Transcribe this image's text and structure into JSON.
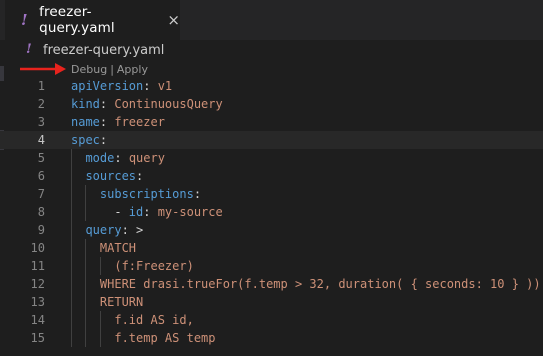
{
  "tab": {
    "icon": "yaml-file-icon",
    "label": "freezer-query.yaml",
    "close": "×"
  },
  "breadcrumb": {
    "icon": "yaml-file-icon",
    "file": "freezer-query.yaml"
  },
  "codelens": {
    "debug": "Debug",
    "separator": "|",
    "apply": "Apply"
  },
  "annotation": {
    "arrow_color": "#e8231d"
  },
  "colors": {
    "key": "#569cd6",
    "value": "#ce9178",
    "plain": "#d4d4d4",
    "line_number": "#858585",
    "yaml_icon": "#a074c4"
  },
  "editor": {
    "active_line": 4,
    "lines": [
      {
        "n": "1",
        "indent": "",
        "key": "apiVersion",
        "sep": ": ",
        "value": "v1"
      },
      {
        "n": "2",
        "indent": "",
        "key": "kind",
        "sep": ": ",
        "value": "ContinuousQuery"
      },
      {
        "n": "3",
        "indent": "",
        "key": "name",
        "sep": ": ",
        "value": "freezer"
      },
      {
        "n": "4",
        "indent": "",
        "key": "spec",
        "sep": ":",
        "value": ""
      },
      {
        "n": "5",
        "indent": "  ",
        "key": "mode",
        "sep": ": ",
        "value": "query"
      },
      {
        "n": "6",
        "indent": "  ",
        "key": "sources",
        "sep": ":",
        "value": ""
      },
      {
        "n": "7",
        "indent": "    ",
        "key": "subscriptions",
        "sep": ":",
        "value": ""
      },
      {
        "n": "8",
        "indent": "      - ",
        "key": "id",
        "sep": ": ",
        "value": "my-source"
      },
      {
        "n": "9",
        "indent": "  ",
        "key": "query",
        "sep": ": ",
        "value": ">"
      },
      {
        "n": "10",
        "indent": "    ",
        "key": "",
        "sep": "",
        "value": "MATCH"
      },
      {
        "n": "11",
        "indent": "      ",
        "key": "",
        "sep": "",
        "value": "(f:Freezer)"
      },
      {
        "n": "12",
        "indent": "    ",
        "key": "",
        "sep": "",
        "value": "WHERE drasi.trueFor(f.temp > 32, duration( { seconds: 10 } ))"
      },
      {
        "n": "13",
        "indent": "    ",
        "key": "",
        "sep": "",
        "value": "RETURN"
      },
      {
        "n": "14",
        "indent": "      ",
        "key": "",
        "sep": "",
        "value": "f.id AS id,"
      },
      {
        "n": "15",
        "indent": "      ",
        "key": "",
        "sep": "",
        "value": "f.temp AS temp"
      }
    ]
  }
}
